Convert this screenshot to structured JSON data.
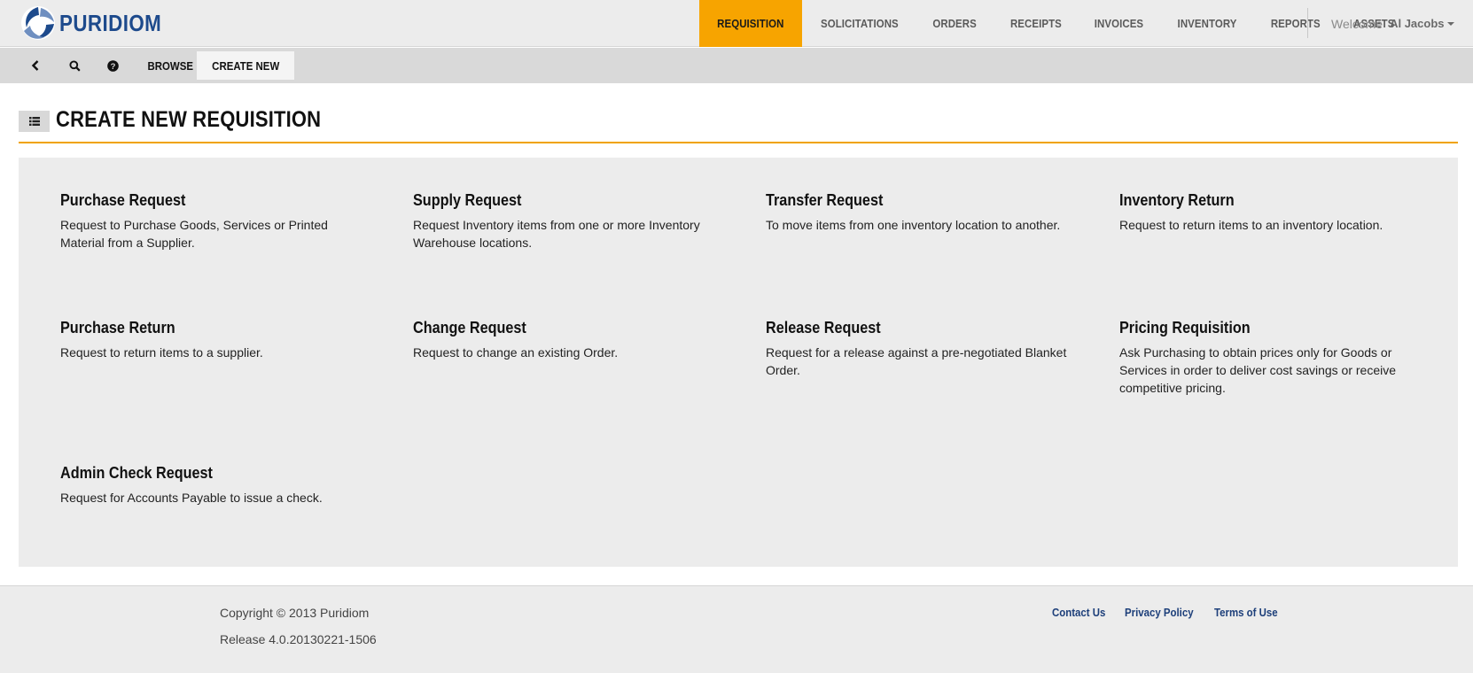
{
  "brand": {
    "name": "PURIDIOM",
    "logo_icon": "puridiom-swirl-logo"
  },
  "nav": {
    "items": [
      {
        "label": "REQUISITION",
        "active": true
      },
      {
        "label": "SOLICITATIONS",
        "active": false
      },
      {
        "label": "ORDERS",
        "active": false
      },
      {
        "label": "RECEIPTS",
        "active": false
      },
      {
        "label": "INVOICES",
        "active": false
      },
      {
        "label": "INVENTORY",
        "active": false
      },
      {
        "label": "REPORTS",
        "active": false
      },
      {
        "label": "ASSETS",
        "active": false
      }
    ],
    "welcome_label": "Welcome",
    "user_name": "Al Jacobs"
  },
  "toolbar": {
    "icons": [
      "back-icon",
      "search-icon",
      "help-icon"
    ],
    "browse_label": "BROWSE",
    "create_new_label": "CREATE NEW"
  },
  "page": {
    "title": "CREATE NEW REQUISITION",
    "title_icon": "list-icon"
  },
  "options": [
    {
      "title": "Purchase Request",
      "description": "Request to Purchase Goods, Services or Printed Material from a Supplier."
    },
    {
      "title": "Supply Request",
      "description": "Request Inventory items from one or more Inventory Warehouse locations."
    },
    {
      "title": "Transfer Request",
      "description": "To move items from one inventory location to another."
    },
    {
      "title": "Inventory Return",
      "description": "Request to return items to an inventory location."
    },
    {
      "title": "Purchase Return",
      "description": "Request to return items to a supplier."
    },
    {
      "title": "Change Request",
      "description": "Request to change an existing Order."
    },
    {
      "title": "Release Request",
      "description": "Request for a release against a pre-negotiated Blanket Order."
    },
    {
      "title": "Pricing Requisition",
      "description": "Ask Purchasing to obtain prices only for Goods or Services in order to deliver cost savings or receive competitive pricing."
    },
    {
      "title": "Admin Check Request",
      "description": "Request for Accounts Payable to issue a check."
    }
  ],
  "footer": {
    "copyright": "Copyright © 2013 Puridiom",
    "release": "Release 4.0.20130221-1506",
    "links": [
      "Contact Us",
      "Privacy Policy",
      "Terms of Use"
    ]
  },
  "colors": {
    "accent": "#f7a400",
    "brand_blue": "#1d4a8c",
    "link_blue": "#1d3f7a",
    "panel_gray": "#ececec"
  }
}
